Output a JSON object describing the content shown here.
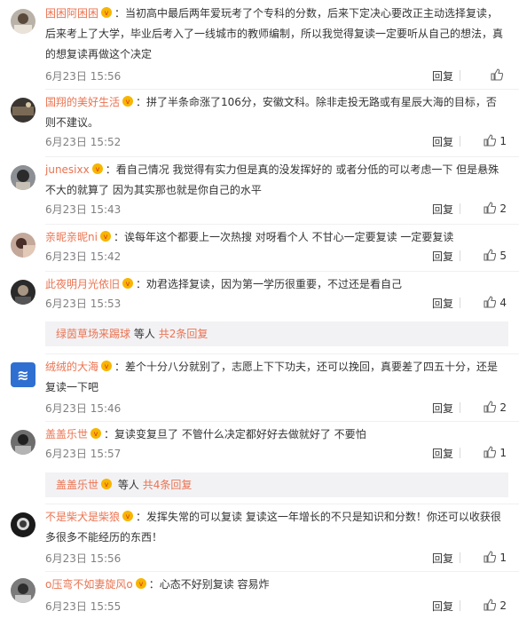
{
  "reply_label": "回复",
  "others_label": "等人",
  "comments": [
    {
      "user": "困困阿困困",
      "badge": true,
      "text": "：当初高中最后两年爱玩考了个专科的分数，后来下定决心要改正主动选择复读，后来考上了大学，毕业后考入了一线城市的教师编制，所以我觉得复读一定要听从自己的想法，真的想复读再做这个决定",
      "time": "6月23日 15:56",
      "likes": ""
    },
    {
      "user": "国翔的美好生活",
      "badge": true,
      "text": "：拼了半条命涨了106分，安徽文科。除非走投无路或有星辰大海的目标，否则不建议。",
      "time": "6月23日 15:52",
      "likes": "1"
    },
    {
      "user": "junesixx",
      "badge": true,
      "text": "：看自己情况 我觉得有实力但是真的没发挥好的 或者分低的可以考虑一下 但是悬殊不大的就算了 因为其实那也就是你自己的水平",
      "time": "6月23日 15:43",
      "likes": "2"
    },
    {
      "user": "亲昵亲昵ni",
      "badge": true,
      "text": "：诶每年这个都要上一次热搜  对呀看个人  不甘心一定要复读 一定要复读",
      "time": "6月23日 15:42",
      "likes": "5"
    },
    {
      "user": "此夜明月光依旧",
      "badge": true,
      "text": "：劝君选择复读，因为第一学历很重要，不过还是看自己",
      "time": "6月23日 15:53",
      "likes": "4"
    },
    {
      "user": "绒绒的大海",
      "badge": true,
      "text": "：差个十分八分就别了，志愿上下下功夫，还可以挽回，真要差了四五十分，还是复读一下吧",
      "time": "6月23日 15:46",
      "likes": "2"
    },
    {
      "user": "盖盖乐世",
      "badge": true,
      "text": "：复读变复旦了 不管什么决定都好好去做就好了 不要怕",
      "time": "6月23日 15:57",
      "likes": "1"
    },
    {
      "user": "不是柴犬是柴狼",
      "badge": true,
      "text": "：发挥失常的可以复读 复读这一年增长的不只是知识和分数！你还可以收获很多很多不能经历的东西！",
      "time": "6月23日 15:56",
      "likes": "1"
    },
    {
      "user": "o压弯不如妻旋风o",
      "badge": true,
      "text": "：心态不好别复读 容易炸",
      "time": "6月23日 15:55",
      "likes": "2"
    }
  ],
  "subreplies": [
    {
      "user": "绿茵草场来踢球",
      "badge": false,
      "count_label": "共2条回复"
    },
    {
      "user": "盖盖乐世",
      "badge": true,
      "count_label": "共4条回复"
    }
  ]
}
